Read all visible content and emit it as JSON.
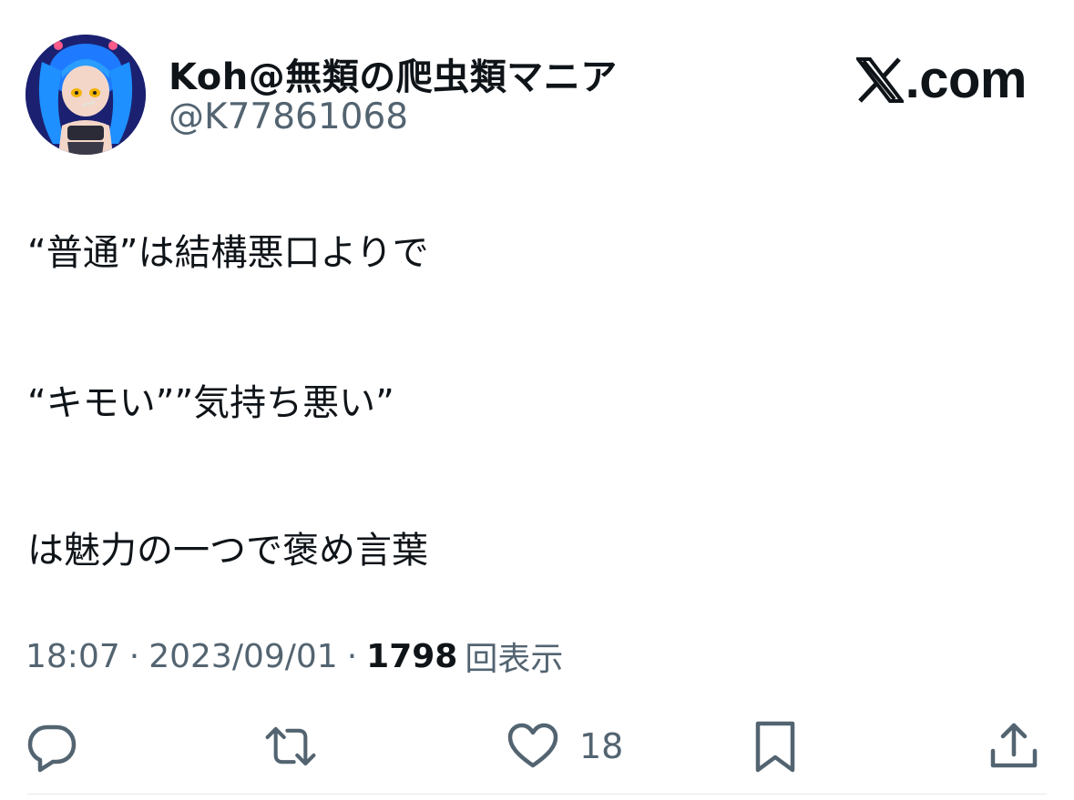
{
  "user": {
    "display_name": "Koh@無類の爬虫類マニア",
    "handle": "@K77861068"
  },
  "brand": {
    "logo_icon": "x-logo-icon",
    "domain_text": ".com"
  },
  "tweet": {
    "paragraphs": [
      "“普通”は結構悪口よりで",
      "“キモい””気持ち悪い”",
      "は魅力の一つで褒め言葉"
    ]
  },
  "meta": {
    "time": "18:07",
    "separator": "·",
    "date": "2023/09/01",
    "views_count": "1798",
    "views_label": "回表示"
  },
  "actions": {
    "reply_icon": "reply-icon",
    "retweet_icon": "retweet-icon",
    "like_icon": "heart-icon",
    "like_count": "18",
    "bookmark_icon": "bookmark-icon",
    "share_icon": "share-icon"
  },
  "colors": {
    "text_primary": "#0f1419",
    "text_secondary": "#536471",
    "icon": "#536471",
    "avatar_bg": "#1d2a8a",
    "avatar_hair": "#1e90ff"
  }
}
